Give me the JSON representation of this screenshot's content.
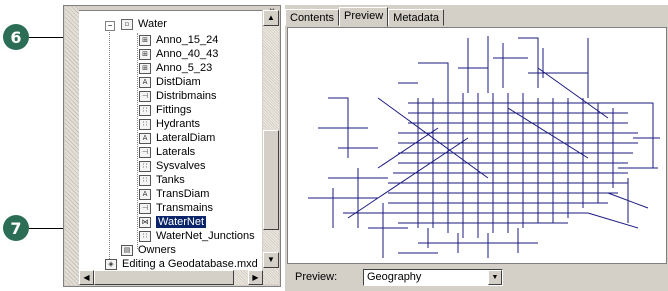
{
  "callouts": [
    {
      "number": "6"
    },
    {
      "number": "7"
    }
  ],
  "tree": {
    "root_label": "Water",
    "items": [
      {
        "label": "Anno_15_24",
        "icon": "annotation-class-icon"
      },
      {
        "label": "Anno_40_43",
        "icon": "annotation-class-icon"
      },
      {
        "label": "Anno_5_23",
        "icon": "annotation-class-icon"
      },
      {
        "label": "DistDiam",
        "icon": "annotation-feature-icon"
      },
      {
        "label": "Distribmains",
        "icon": "line-feature-icon"
      },
      {
        "label": "Fittings",
        "icon": "point-feature-icon"
      },
      {
        "label": "Hydrants",
        "icon": "point-feature-icon"
      },
      {
        "label": "LateralDiam",
        "icon": "annotation-feature-icon"
      },
      {
        "label": "Laterals",
        "icon": "line-feature-icon"
      },
      {
        "label": "Sysvalves",
        "icon": "point-feature-icon"
      },
      {
        "label": "Tanks",
        "icon": "point-feature-icon"
      },
      {
        "label": "TransDiam",
        "icon": "annotation-feature-icon"
      },
      {
        "label": "Transmains",
        "icon": "line-feature-icon"
      },
      {
        "label": "WaterNet",
        "icon": "geometric-network-icon",
        "selected": true
      },
      {
        "label": "WaterNet_Junctions",
        "icon": "point-feature-icon"
      }
    ],
    "owners_label": "Owners",
    "owners_icon": "table-icon",
    "partial_label": "Editing a Geodatabase.mxd"
  },
  "tabs": [
    {
      "label": "Contents",
      "active": false
    },
    {
      "label": "Preview",
      "active": true
    },
    {
      "label": "Metadata",
      "active": false
    }
  ],
  "preview": {
    "label": "Preview:",
    "selected_option": "Geography"
  },
  "colors": {
    "callout": "#2b6e55",
    "selection": "#0a246a",
    "network_lines": "#1a1a80"
  }
}
